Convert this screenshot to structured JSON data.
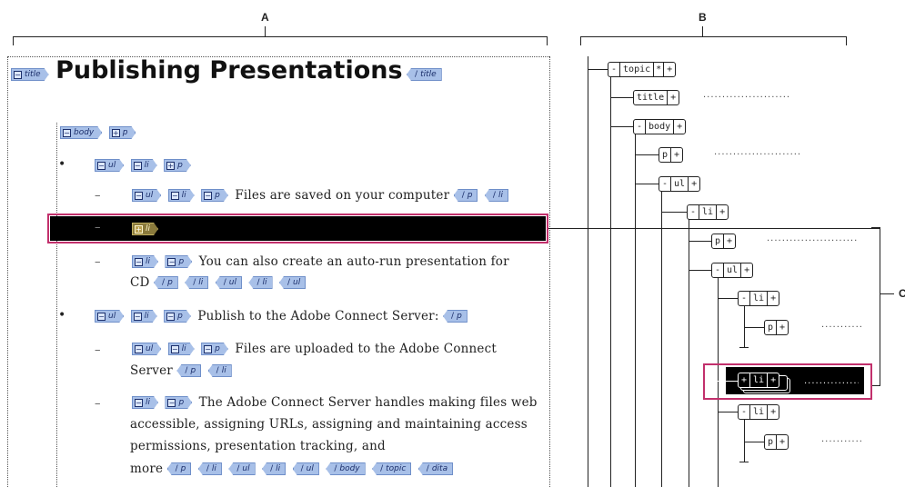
{
  "callouts": {
    "a": "A",
    "b": "B",
    "c": "C"
  },
  "document": {
    "title_tag_open": "title",
    "title_text": "Publishing Presentations",
    "title_tag_close": "title",
    "body_tag": "body",
    "p_tag": "p",
    "ul_tag": "ul",
    "li_tag": "li",
    "topic_tag": "topic",
    "dita_tag": "dita",
    "text_1": "Files are saved on your computer",
    "text_2a": "You can also create an auto-run presentation for",
    "text_2b": "CD",
    "text_3": "Publish to the Adobe Connect Server:",
    "text_4a": "Files are uploaded to the Adobe Connect",
    "text_4b": "Server",
    "text_5a": "The Adobe Connect Server handles making files web",
    "text_5b": "accessible, assigning URLs, assigning and maintaining access",
    "text_5c": "permissions, presentation tracking, and",
    "text_5d": "more",
    "bullet": "•",
    "dash": "–"
  },
  "tree": {
    "topic": {
      "minus": "-",
      "label": "topic",
      "star": "*",
      "plus": "+"
    },
    "title": {
      "label": "title",
      "plus": "+"
    },
    "body": {
      "minus": "-",
      "label": "body",
      "plus": "+"
    },
    "p": {
      "label": "p",
      "plus": "+"
    },
    "ul": {
      "minus": "-",
      "label": "ul",
      "plus": "+"
    },
    "li": {
      "minus": "-",
      "label": "li",
      "plus": "+"
    },
    "li_collapsed": {
      "plus_a": "+",
      "label": "li",
      "plus_b": "+"
    },
    "dots": "........................"
  },
  "colors": {
    "selection": "#000000",
    "highlight": "#c2306c",
    "tag_fill": "#a8c0e8",
    "tag_border": "#6f8fc9"
  }
}
